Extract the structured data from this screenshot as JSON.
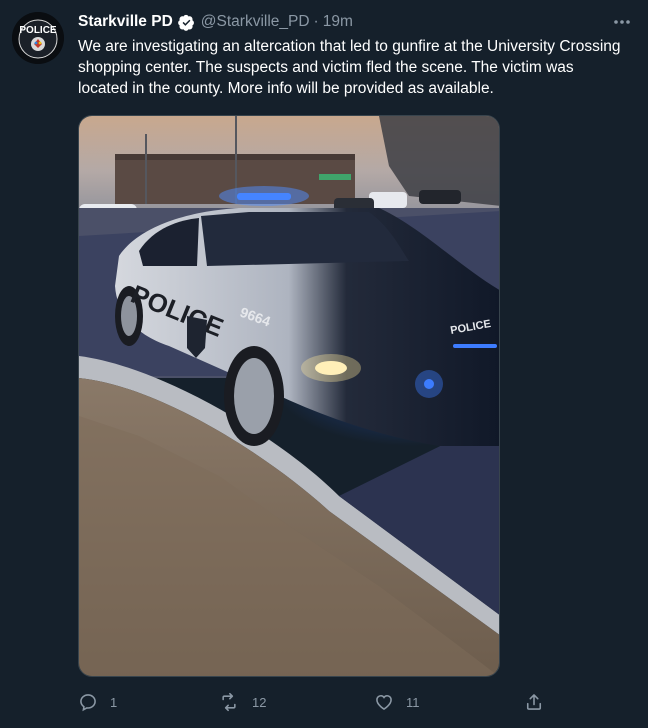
{
  "tweet": {
    "author_name": "Starkville PD",
    "handle": "@Starkville_PD",
    "separator": "·",
    "time": "19m",
    "text": "We are investigating an altercation that led to gunfire at the University Crossing shopping center. The suspects and victim fled the scene. The victim was located in the county. More info will be provided as available.",
    "avatar_badge_text": "POLICE",
    "photo": {
      "car_door_text": "POLICE",
      "car_number": "9664",
      "hood_text": "POLICE"
    }
  },
  "actions": {
    "reply_count": "1",
    "retweet_count": "12",
    "like_count": "11"
  },
  "icons": {
    "verified": "verified-badge-icon",
    "more": "more-options-icon",
    "reply": "reply-icon",
    "retweet": "retweet-icon",
    "like": "like-icon",
    "share": "share-icon"
  },
  "colors": {
    "background": "#15202b",
    "text_primary": "#ffffff",
    "text_secondary": "#8b98a5",
    "verified_blue": "#1d9bf0"
  }
}
